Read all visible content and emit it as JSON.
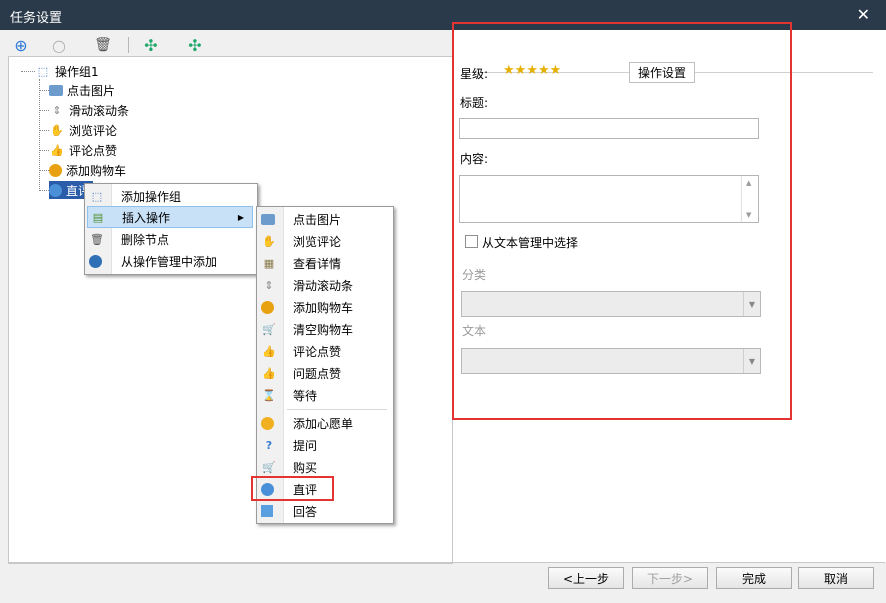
{
  "window": {
    "title": "任务设置",
    "close_glyph": "✕"
  },
  "toolbar": {
    "buttons": [
      {
        "name": "add-icon",
        "glyph": "⊕",
        "color": "#2e7bd6"
      },
      {
        "name": "disabled-icon",
        "glyph": "○",
        "color": "#b0b0b0"
      },
      {
        "name": "trash-icon",
        "glyph": "🗑",
        "color": "#555555"
      },
      {
        "name": "expand-icon",
        "glyph": "✣",
        "color": "#1fa86a"
      },
      {
        "name": "collapse-icon",
        "glyph": "✣",
        "color": "#1fa86a"
      }
    ]
  },
  "tree": {
    "root": {
      "label": "操作组1"
    },
    "items": [
      {
        "label": "点击图片",
        "icon": "picture-icon"
      },
      {
        "label": "滑动滚动条",
        "icon": "scroll-icon"
      },
      {
        "label": "浏览评论",
        "icon": "hand-icon"
      },
      {
        "label": "评论点赞",
        "icon": "thumbs-up-icon"
      },
      {
        "label": "添加购物车",
        "icon": "cart-add-icon"
      },
      {
        "label": "直评",
        "icon": "comment-icon"
      }
    ]
  },
  "context_menu": {
    "items": [
      {
        "label": "添加操作组",
        "icon": "cursor-icon"
      },
      {
        "label": "插入操作",
        "icon": "insert-icon",
        "has_submenu": true,
        "selected": true
      },
      {
        "label": "删除节点",
        "icon": "trash-icon"
      },
      {
        "label": "从操作管理中添加",
        "icon": "globe-icon"
      }
    ],
    "submenu_arrow": "▶"
  },
  "submenu": {
    "group1": [
      {
        "label": "点击图片",
        "icon": "picture-icon"
      },
      {
        "label": "浏览评论",
        "icon": "hand-icon"
      },
      {
        "label": "查看详情",
        "icon": "details-icon"
      },
      {
        "label": "滑动滚动条",
        "icon": "scroll-icon"
      },
      {
        "label": "添加购物车",
        "icon": "cart-add-icon"
      },
      {
        "label": "清空购物车",
        "icon": "cart-empty-icon"
      },
      {
        "label": "评论点赞",
        "icon": "thumbs-up-icon"
      },
      {
        "label": "问题点赞",
        "icon": "thumbs-up-icon"
      },
      {
        "label": "等待",
        "icon": "hourglass-icon"
      }
    ],
    "group2": [
      {
        "label": "添加心愿单",
        "icon": "wishlist-icon"
      },
      {
        "label": "提问",
        "icon": "question-icon"
      },
      {
        "label": "购买",
        "icon": "buy-icon"
      },
      {
        "label": "直评",
        "icon": "comment-icon",
        "highlighted": true
      },
      {
        "label": "回答",
        "icon": "answer-icon"
      }
    ]
  },
  "settings": {
    "legend": "操作设置",
    "star_label": "星级:",
    "stars": 5,
    "star_glyph": "★",
    "title_label": "标题:",
    "title_value": "",
    "content_label": "内容:",
    "content_value": "",
    "select_from_text_label": "从文本管理中选择",
    "select_from_text_checked": false,
    "category_label": "分类",
    "category_value": "",
    "text_label": "文本",
    "text_value": "",
    "combo_arrow": "▼",
    "scroll_up": "▲",
    "scroll_down": "▼"
  },
  "footer": {
    "prev_label": "<上一步",
    "next_label": "下一步>",
    "finish_label": "完成",
    "cancel_label": "取消"
  },
  "highlight_color": "#e33333"
}
